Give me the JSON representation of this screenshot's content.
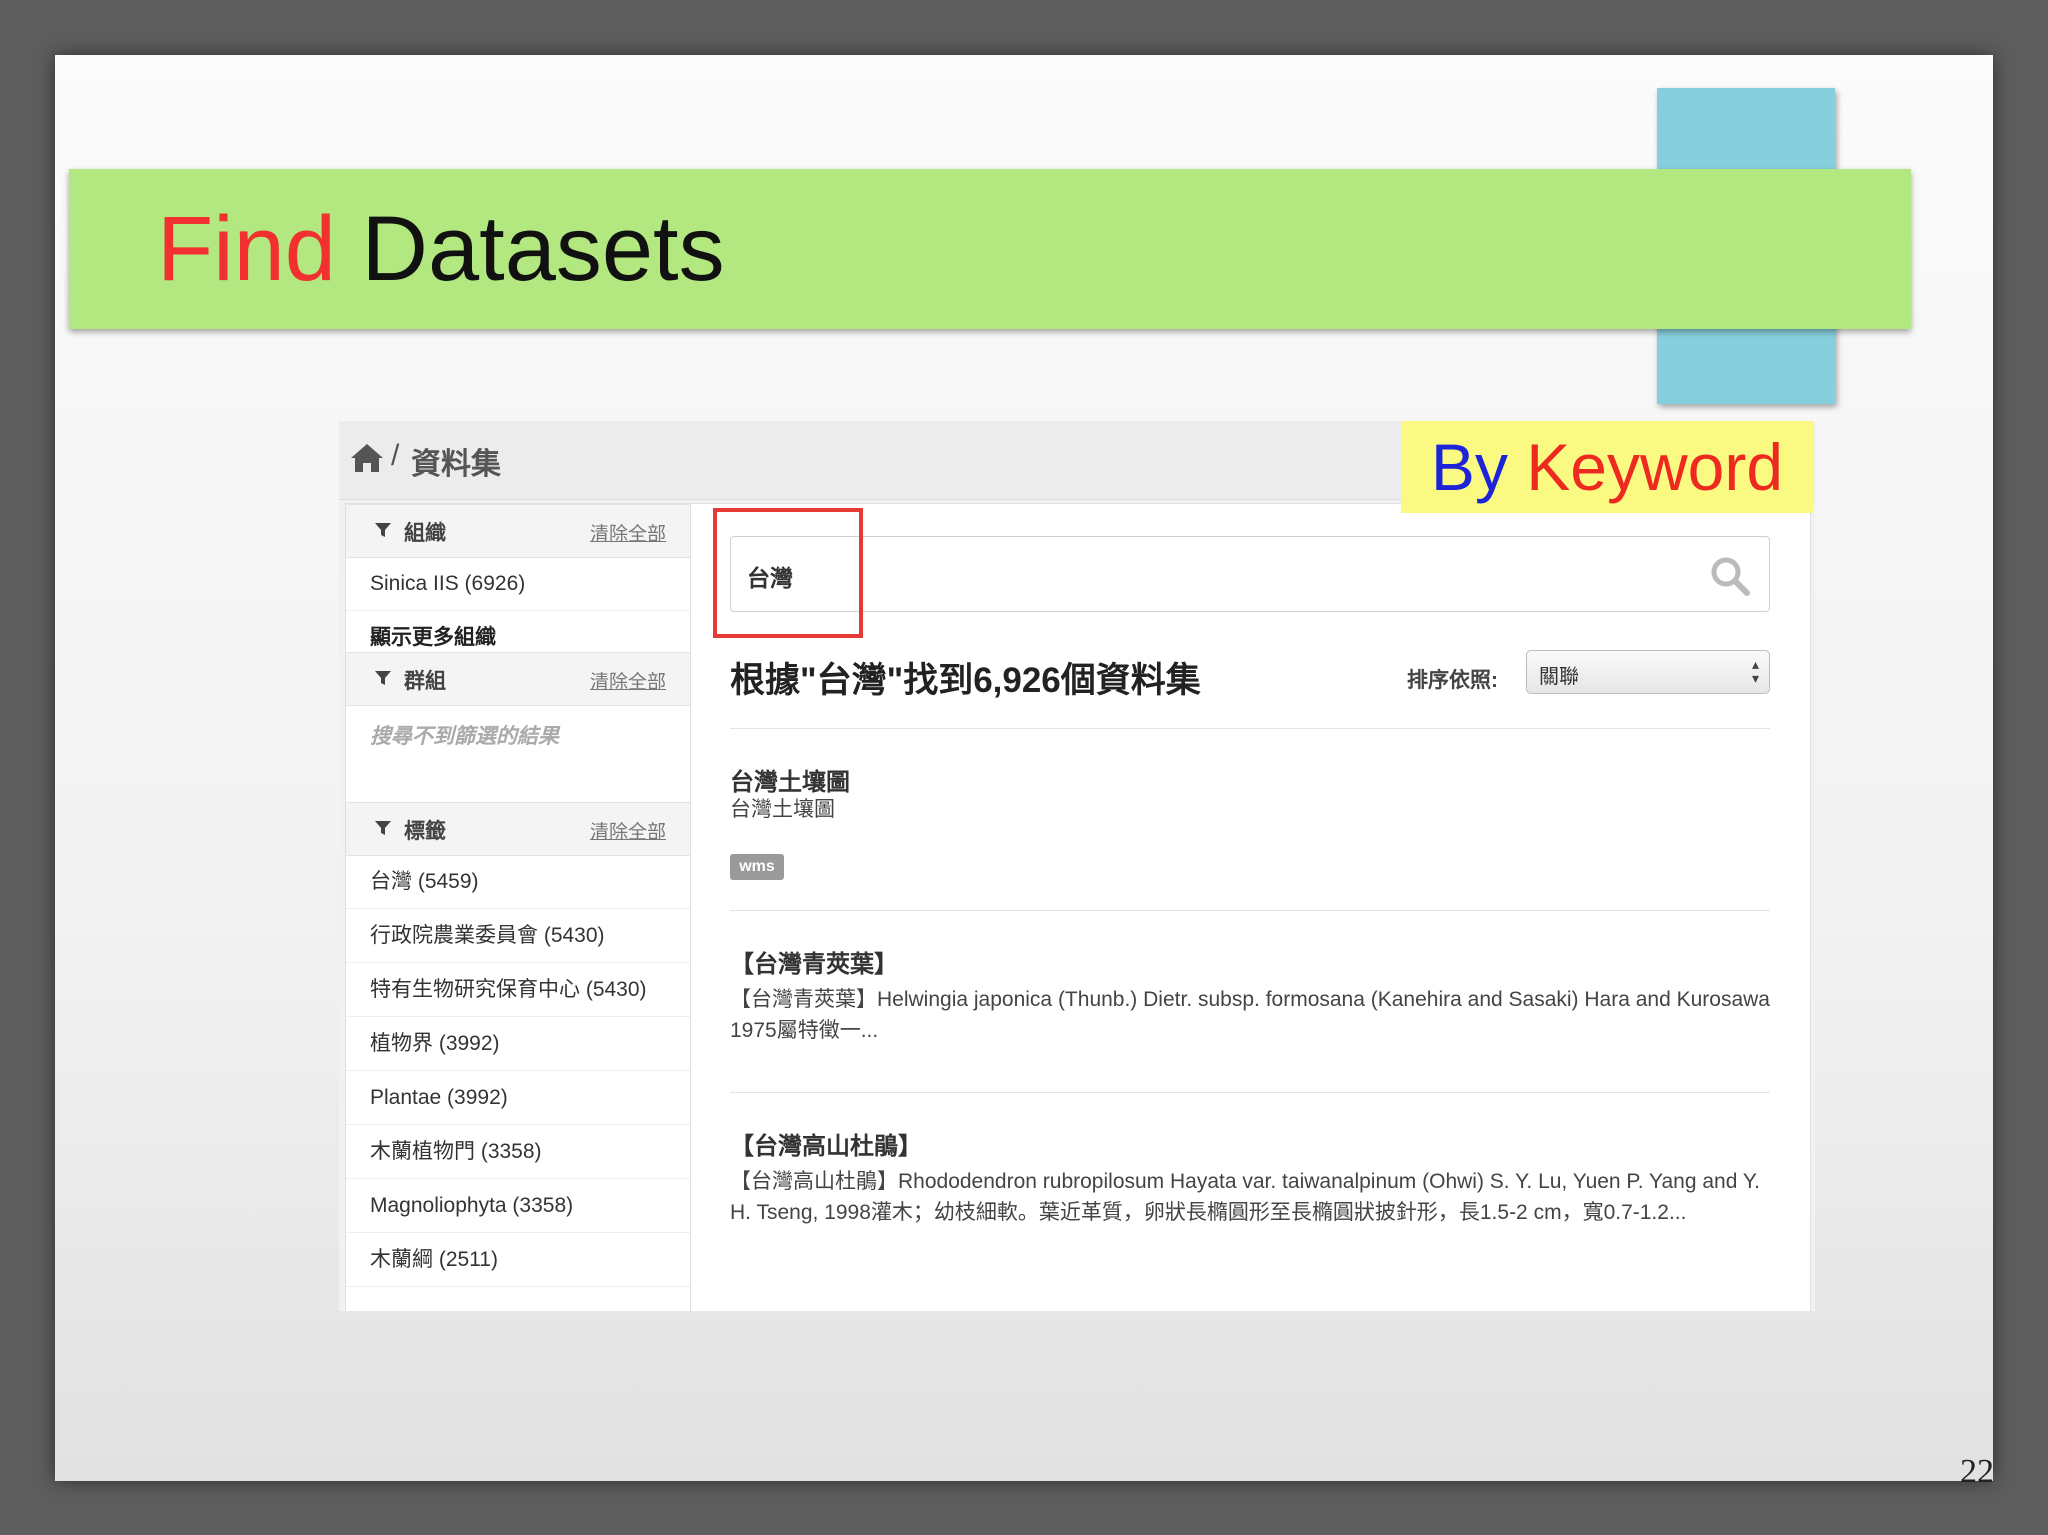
{
  "slide": {
    "title_find": "Find",
    "title_rest": " Datasets",
    "page_number": "22",
    "colors": {
      "title_bar": "#b3e77f",
      "accent_rect": "#86cfdd",
      "find_red": "#f1302f"
    }
  },
  "badge": {
    "by": "By",
    "keyword": " Keyword"
  },
  "breadcrumb": {
    "home_icon": "home-icon",
    "separator": "/",
    "label": "資料集"
  },
  "sidebar": {
    "clear_all": "清除全部",
    "organizations": {
      "title": "組織",
      "items": [
        "Sinica IIS (6926)"
      ],
      "more": "顯示更多組織"
    },
    "groups": {
      "title": "群組",
      "empty": "搜尋不到篩選的結果"
    },
    "tags": {
      "title": "標籤",
      "items": [
        "台灣 (5459)",
        "行政院農業委員會 (5430)",
        "特有生物研究保育中心 (5430)",
        "植物界 (3992)",
        "Plantae (3992)",
        "木蘭植物門 (3358)",
        "Magnoliophyta (3358)",
        "木蘭綱 (2511)"
      ]
    }
  },
  "search": {
    "value": "台灣",
    "icon": "search-icon"
  },
  "results": {
    "heading": "根據\"台灣\"找到6,926個資料集",
    "sort_label": "排序依照:",
    "sort_value": "關聯",
    "datasets": [
      {
        "title": "台灣土壤圖",
        "desc": "台灣土壤圖",
        "tag": "wms"
      },
      {
        "title": "【台灣青莢葉】",
        "desc": "【台灣青莢葉】Helwingia japonica (Thunb.) Dietr. subsp. formosana (Kanehira and Sasaki) Hara and Kurosawa 1975屬特徵一..."
      },
      {
        "title": "【台灣高山杜鵑】",
        "desc": "【台灣高山杜鵑】Rhododendron rubropilosum Hayata var. taiwanalpinum (Ohwi) S. Y. Lu, Yuen P. Yang and Y. H. Tseng, 1998灌木；幼枝細軟。葉近革質，卵狀長橢圓形至長橢圓狀披針形，長1.5-2 cm，寬0.7-1.2..."
      }
    ]
  }
}
